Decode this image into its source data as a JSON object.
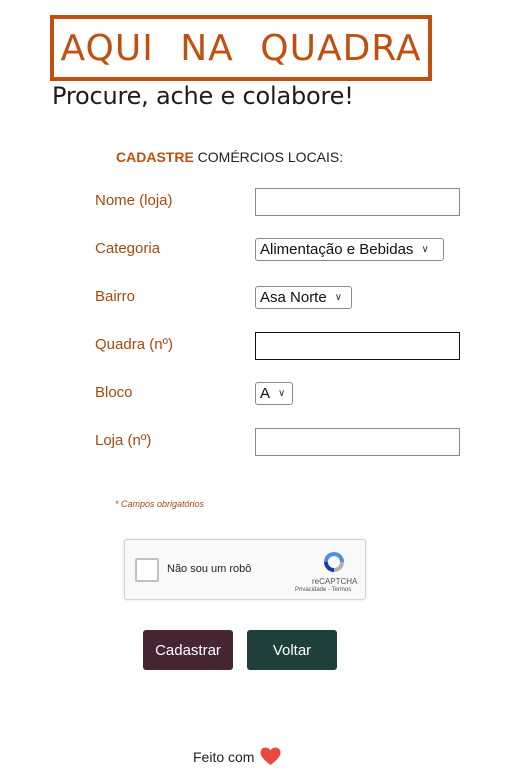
{
  "header": {
    "logo_text": "AQUI NA QUADRA",
    "tagline": "Procure, ache e colabore!"
  },
  "form": {
    "title_strong": "CADASTRE",
    "title_rest": " COMÉRCIOS LOCAIS:",
    "fields": {
      "nome": {
        "label": "Nome (loja)",
        "value": ""
      },
      "categoria": {
        "label": "Categoria",
        "value": "Alimentação e Bebidas"
      },
      "bairro": {
        "label": "Bairro",
        "value": "Asa Norte"
      },
      "quadra": {
        "label": "Quadra (nº)",
        "value": ""
      },
      "bloco": {
        "label": "Bloco",
        "value": "A"
      },
      "loja": {
        "label": "Loja (nº)",
        "value": ""
      }
    },
    "required_note": "* Campos obrigatórios"
  },
  "captcha": {
    "label": "Não sou um robô",
    "brand": "reCAPTCHA",
    "links": "Privacidade - Termos"
  },
  "buttons": {
    "submit": "Cadastrar",
    "back": "Voltar"
  },
  "footer": {
    "text": "Feito com"
  },
  "colors": {
    "accent": "#c0500f",
    "button_primary": "#472634",
    "button_secondary": "#1f3f3b",
    "heart": "#e84a3f"
  }
}
